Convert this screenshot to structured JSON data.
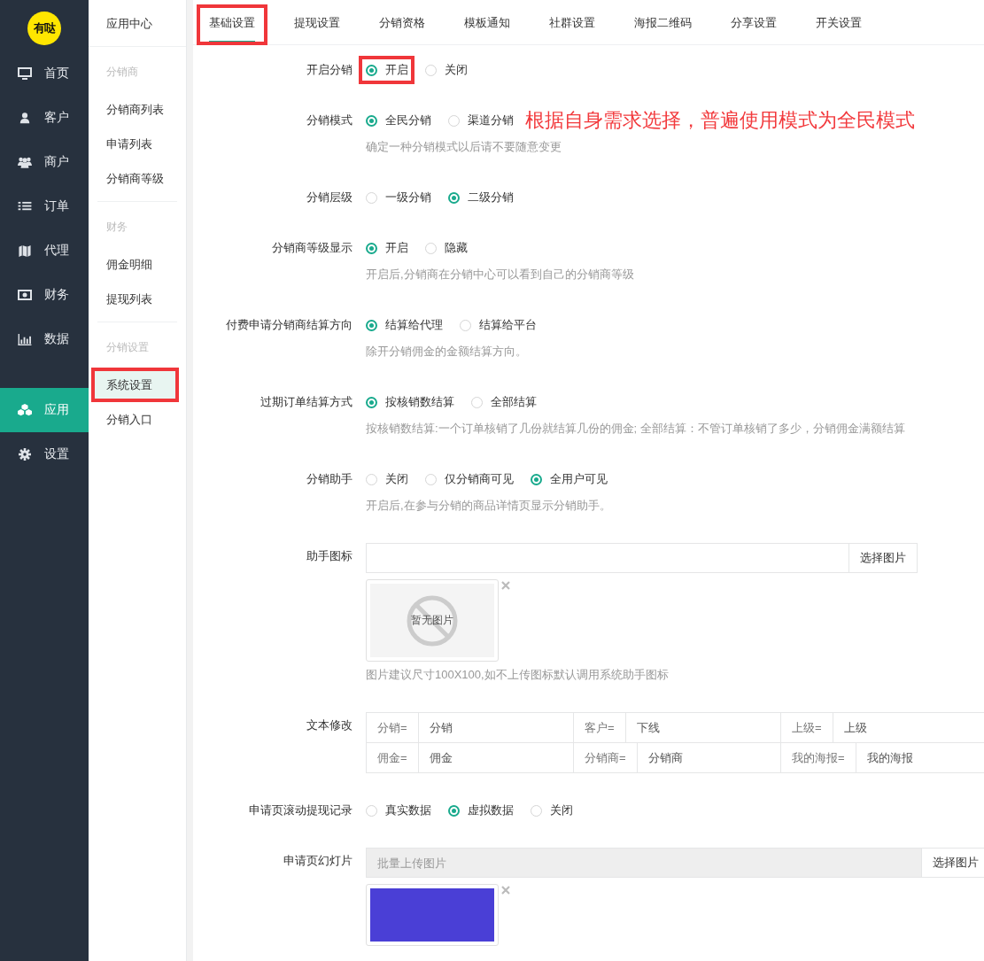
{
  "logo": {
    "text": "有哒"
  },
  "nav": [
    {
      "label": "首页",
      "selected": false
    },
    {
      "label": "客户",
      "selected": false
    },
    {
      "label": "商户",
      "selected": false
    },
    {
      "label": "订单",
      "selected": false
    },
    {
      "label": "代理",
      "selected": false
    },
    {
      "label": "财务",
      "selected": false
    },
    {
      "label": "数据",
      "selected": false
    },
    {
      "label": "应用",
      "selected": true
    },
    {
      "label": "设置",
      "selected": false
    }
  ],
  "subnav": {
    "title": "应用中心",
    "groups": [
      {
        "heading": "分销商",
        "items": [
          {
            "label": "分销商列表",
            "selected": false,
            "annotated": false
          },
          {
            "label": "申请列表",
            "selected": false,
            "annotated": false
          },
          {
            "label": "分销商等级",
            "selected": false,
            "annotated": false
          }
        ]
      },
      {
        "heading": "财务",
        "items": [
          {
            "label": "佣金明细",
            "selected": false,
            "annotated": false
          },
          {
            "label": "提现列表",
            "selected": false,
            "annotated": false
          }
        ]
      },
      {
        "heading": "分销设置",
        "items": [
          {
            "label": "系统设置",
            "selected": true,
            "annotated": true
          },
          {
            "label": "分销入口",
            "selected": false,
            "annotated": false
          }
        ]
      }
    ]
  },
  "tabs": [
    {
      "label": "基础设置",
      "selected": true,
      "annotated": true
    },
    {
      "label": "提现设置",
      "selected": false,
      "annotated": false
    },
    {
      "label": "分销资格",
      "selected": false,
      "annotated": false
    },
    {
      "label": "模板通知",
      "selected": false,
      "annotated": false
    },
    {
      "label": "社群设置",
      "selected": false,
      "annotated": false
    },
    {
      "label": "海报二维码",
      "selected": false,
      "annotated": false
    },
    {
      "label": "分享设置",
      "selected": false,
      "annotated": false
    },
    {
      "label": "开关设置",
      "selected": false,
      "annotated": false
    }
  ],
  "form": [
    {
      "kind": "radio",
      "label": "开启分销",
      "options": [
        {
          "label": "开启",
          "selected": true,
          "annotated": true
        },
        {
          "label": "关闭",
          "selected": false,
          "annotated": false
        }
      ]
    },
    {
      "kind": "radio",
      "label": "分销模式",
      "options": [
        {
          "label": "全民分销",
          "selected": true,
          "annotated": false
        },
        {
          "label": "渠道分销",
          "selected": false,
          "annotated": false
        }
      ],
      "note": "根据自身需求选择，普遍使用模式为全民模式",
      "hint": "确定一种分销模式以后请不要随意变更"
    },
    {
      "kind": "radio",
      "label": "分销层级",
      "options": [
        {
          "label": "一级分销",
          "selected": false,
          "annotated": false
        },
        {
          "label": "二级分销",
          "selected": true,
          "annotated": false
        }
      ]
    },
    {
      "kind": "radio",
      "label": "分销商等级显示",
      "options": [
        {
          "label": "开启",
          "selected": true,
          "annotated": false
        },
        {
          "label": "隐藏",
          "selected": false,
          "annotated": false
        }
      ],
      "hint": "开启后,分销商在分销中心可以看到自己的分销商等级"
    },
    {
      "kind": "radio",
      "label": "付费申请分销商结算方向",
      "options": [
        {
          "label": "结算给代理",
          "selected": true,
          "annotated": false
        },
        {
          "label": "结算给平台",
          "selected": false,
          "annotated": false
        }
      ],
      "hint": "除开分销佣金的金额结算方向。"
    },
    {
      "kind": "radio",
      "label": "过期订单结算方式",
      "options": [
        {
          "label": "按核销数结算",
          "selected": true,
          "annotated": false
        },
        {
          "label": "全部结算",
          "selected": false,
          "annotated": false
        }
      ],
      "hint": "按核销数结算:一个订单核销了几份就结算几份的佣金; 全部结算：不管订单核销了多少，分销佣金满额结算"
    },
    {
      "kind": "radio",
      "label": "分销助手",
      "options": [
        {
          "label": "关闭",
          "selected": false,
          "annotated": false
        },
        {
          "label": "仅分销商可见",
          "selected": false,
          "annotated": false
        },
        {
          "label": "全用户可见",
          "selected": true,
          "annotated": false
        }
      ],
      "hint": "开启后,在参与分销的商品详情页显示分销助手。"
    },
    {
      "kind": "image",
      "label": "助手图标",
      "button": "选择图片",
      "empty_text": "暂无图片",
      "hint": "图片建议尺寸100X100,如不上传图标默认调用系统助手图标"
    },
    {
      "kind": "text_map",
      "label": "文本修改",
      "rows": [
        [
          {
            "key": "分销=",
            "value": "分销"
          },
          {
            "key": "客户=",
            "value": "下线"
          },
          {
            "key": "上级=",
            "value": "上级"
          }
        ],
        [
          {
            "key": "佣金=",
            "value": "佣金"
          },
          {
            "key": "分销商=",
            "value": "分销商"
          },
          {
            "key": "我的海报=",
            "value": "我的海报"
          }
        ]
      ]
    },
    {
      "kind": "radio",
      "label": "申请页滚动提现记录",
      "options": [
        {
          "label": "真实数据",
          "selected": false,
          "annotated": false
        },
        {
          "label": "虚拟数据",
          "selected": true,
          "annotated": false
        },
        {
          "label": "关闭",
          "selected": false,
          "annotated": false
        }
      ]
    },
    {
      "kind": "gallery",
      "label": "申请页幻灯片",
      "placeholder": "批量上传图片",
      "button": "选择图片"
    }
  ]
}
